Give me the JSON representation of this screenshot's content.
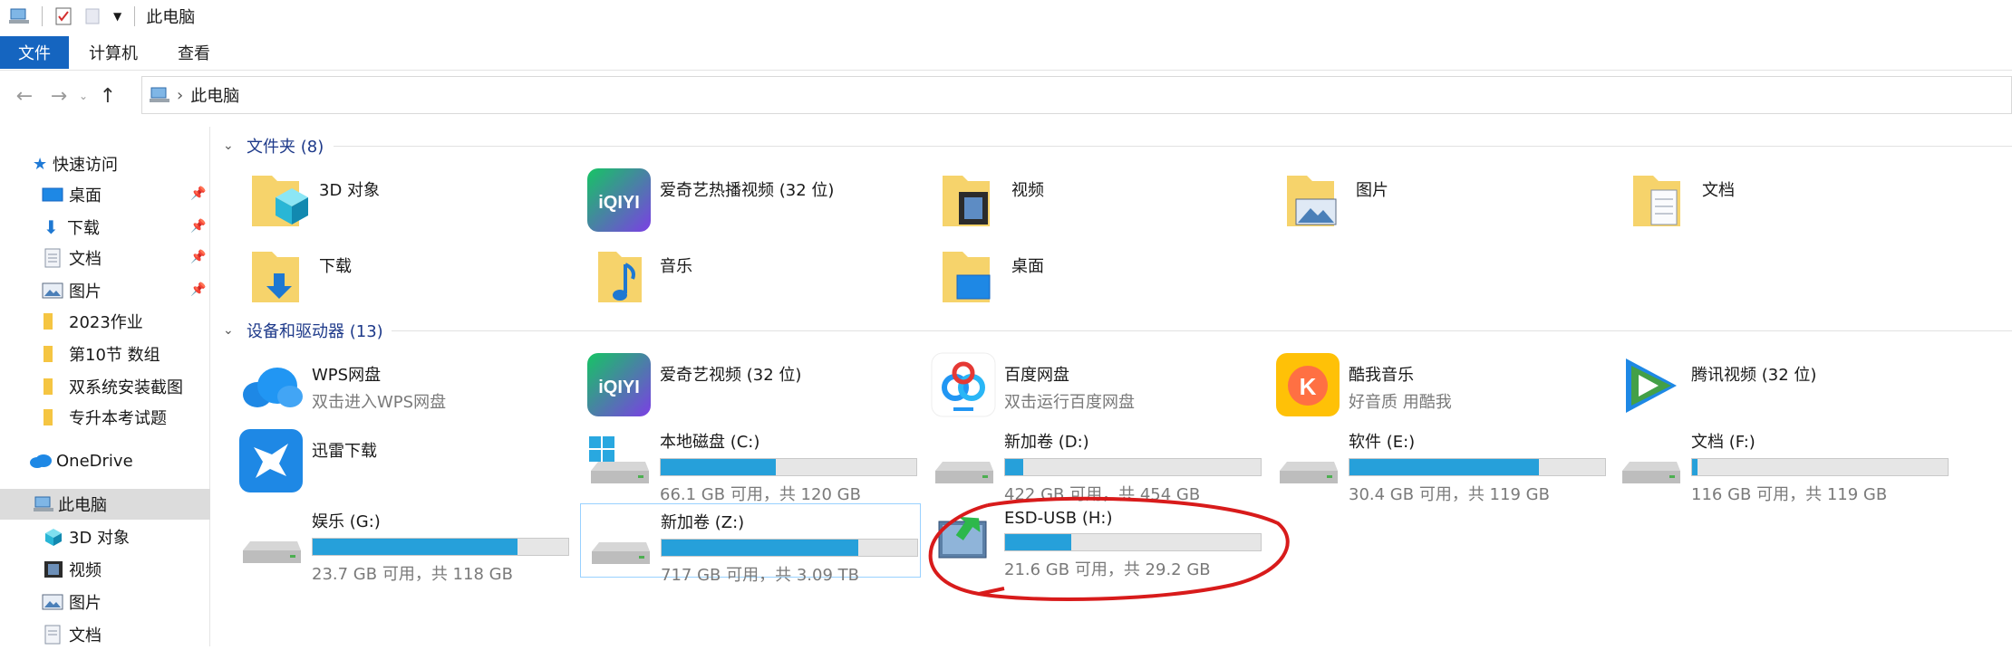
{
  "window": {
    "title": "此电脑"
  },
  "ribbon": {
    "tabs": [
      "文件",
      "计算机",
      "查看"
    ]
  },
  "address": {
    "path": "此电脑"
  },
  "sidebar": {
    "items": [
      {
        "label": "快速访问",
        "icon": "star-icon"
      },
      {
        "label": "桌面",
        "icon": "desktop-icon",
        "pinned": true
      },
      {
        "label": "下载",
        "icon": "download-icon",
        "pinned": true
      },
      {
        "label": "文档",
        "icon": "documents-icon",
        "pinned": true
      },
      {
        "label": "图片",
        "icon": "pictures-icon",
        "pinned": true
      },
      {
        "label": "2023作业",
        "icon": "folder-icon"
      },
      {
        "label": "第10节 数组",
        "icon": "folder-icon"
      },
      {
        "label": "双系统安装截图",
        "icon": "folder-icon"
      },
      {
        "label": "专升本考试题",
        "icon": "folder-icon"
      },
      {
        "label": "OneDrive",
        "icon": "cloud-icon"
      },
      {
        "label": "此电脑",
        "icon": "computer-icon",
        "selected": true
      },
      {
        "label": "3D 对象",
        "icon": "cube-icon"
      },
      {
        "label": "视频",
        "icon": "video-icon"
      },
      {
        "label": "图片",
        "icon": "pictures-icon"
      },
      {
        "label": "文档",
        "icon": "documents-icon"
      }
    ]
  },
  "folders": {
    "header": "文件夹 (8)",
    "items": [
      {
        "name": "3D 对象",
        "icon": "cube-folder-icon"
      },
      {
        "name": "爱奇艺热播视频 (32 位)",
        "icon": "iqiyi-icon"
      },
      {
        "name": "视频",
        "icon": "video-folder-icon"
      },
      {
        "name": "图片",
        "icon": "pictures-folder-icon"
      },
      {
        "name": "文档",
        "icon": "documents-folder-icon"
      },
      {
        "name": "下载",
        "icon": "download-folder-icon"
      },
      {
        "name": "音乐",
        "icon": "music-folder-icon"
      },
      {
        "name": "桌面",
        "icon": "desktop-folder-icon"
      }
    ]
  },
  "devices": {
    "header": "设备和驱动器 (13)",
    "apps": [
      {
        "name": "WPS网盘",
        "sub": "双击进入WPS网盘",
        "icon": "wps-cloud-icon"
      },
      {
        "name": "爱奇艺视频 (32 位)",
        "sub": "",
        "icon": "iqiyi-icon"
      },
      {
        "name": "百度网盘",
        "sub": "双击运行百度网盘",
        "icon": "baidu-netdisk-icon"
      },
      {
        "name": "酷我音乐",
        "sub": "好音质 用酷我",
        "icon": "kuwo-icon"
      },
      {
        "name": "腾讯视频 (32 位)",
        "sub": "",
        "icon": "tencent-video-icon"
      },
      {
        "name": "迅雷下载",
        "sub": "",
        "icon": "xunlei-icon"
      }
    ],
    "drives": [
      {
        "name": "本地磁盘 (C:)",
        "free": "66.1 GB 可用，共 120 GB",
        "used_fraction": 0.45,
        "icon": "windows-drive-icon"
      },
      {
        "name": "新加卷 (D:)",
        "free": "422 GB 可用，共 454 GB",
        "used_fraction": 0.07,
        "icon": "hard-drive-icon"
      },
      {
        "name": "软件 (E:)",
        "free": "30.4 GB 可用，共 119 GB",
        "used_fraction": 0.74,
        "icon": "hard-drive-icon"
      },
      {
        "name": "文档 (F:)",
        "free": "116 GB 可用，共 119 GB",
        "used_fraction": 0.02,
        "icon": "hard-drive-icon"
      },
      {
        "name": "娱乐 (G:)",
        "free": "23.7 GB 可用，共 118 GB",
        "used_fraction": 0.8,
        "icon": "hard-drive-icon"
      },
      {
        "name": "新加卷 (Z:)",
        "free": "717 GB 可用，共 3.09 TB",
        "used_fraction": 0.77,
        "icon": "hard-drive-icon",
        "selected": true
      },
      {
        "name": "ESD-USB (H:)",
        "free": "21.6 GB 可用，共 29.2 GB",
        "used_fraction": 0.26,
        "icon": "usb-install-icon"
      }
    ]
  },
  "colors": {
    "accent": "#1565c0",
    "bar_fill": "#26a0da",
    "annotation": "#d81b1b"
  }
}
